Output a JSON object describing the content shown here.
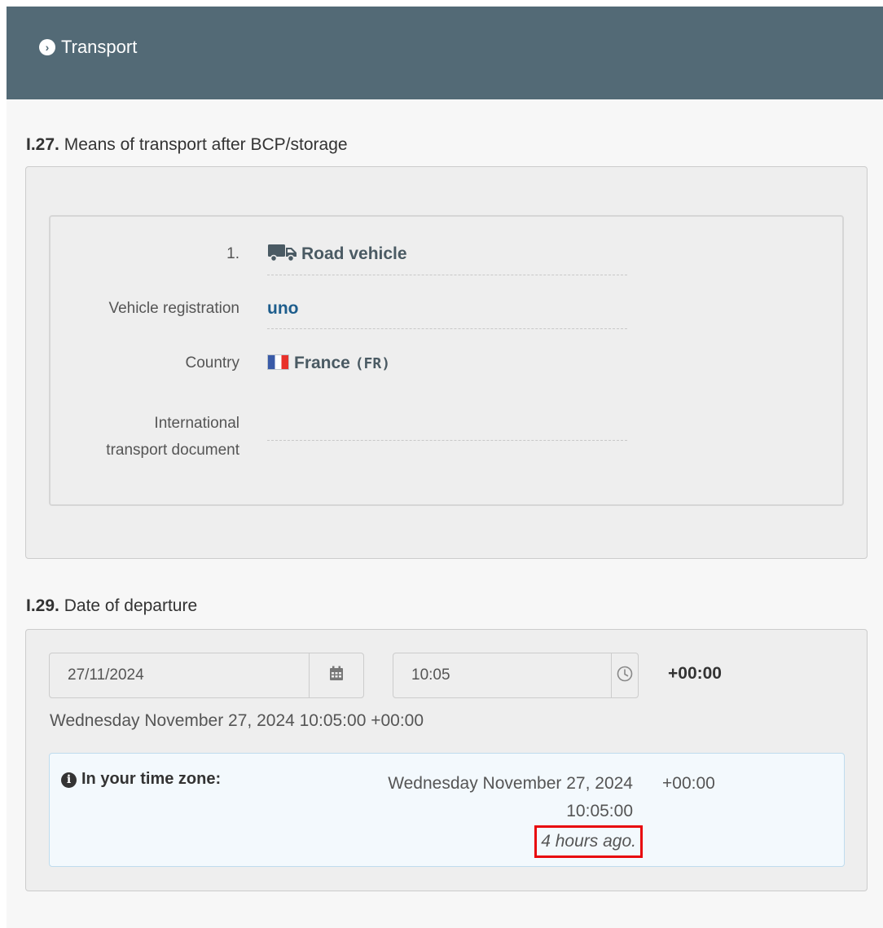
{
  "header": {
    "title": "Transport",
    "icon": "chevron-right-circle-icon"
  },
  "section_27": {
    "number": "I.27.",
    "title": "Means of transport after BCP/storage",
    "entry": {
      "index_label": "1.",
      "type_icon": "truck-icon",
      "type_value": "Road vehicle",
      "vehicle_registration_label": "Vehicle registration",
      "vehicle_registration_value": "uno",
      "country_label": "Country",
      "country_flag": "france-flag-icon",
      "country_name": "France",
      "country_code": "(FR)",
      "transport_doc_label_line1": "International",
      "transport_doc_label_line2": "transport document",
      "transport_doc_value": ""
    }
  },
  "section_29": {
    "number": "I.29.",
    "title": "Date of departure",
    "date_value": "27/11/2024",
    "date_icon": "calendar-icon",
    "time_value": "10:05",
    "time_icon": "clock-icon",
    "offset": "+00:00",
    "full_date": "Wednesday November 27, 2024 10:05:00 +00:00",
    "timezone": {
      "label": "In your time zone:",
      "date_line": "Wednesday November 27, 2024",
      "time_line": "10:05:00",
      "relative": "4 hours ago.",
      "offset": "+00:00"
    }
  },
  "colors": {
    "header_bg": "#536a76",
    "value_blue": "#1d5d8c",
    "highlight_red": "#e8080d",
    "info_box_bg": "#f3f9fd"
  }
}
